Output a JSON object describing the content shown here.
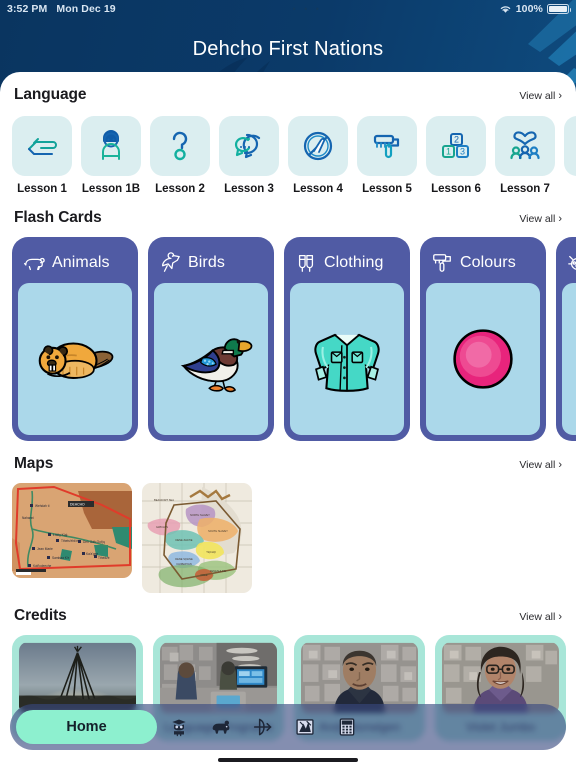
{
  "status_bar": {
    "time": "3:52 PM",
    "date": "Mon Dec 19",
    "center_dots": "• • •",
    "battery_percent": "100%",
    "wifi_icon": "wifi-icon",
    "battery_icon": "battery-full-icon"
  },
  "header": {
    "title": "Dehcho First Nations"
  },
  "sections": {
    "language": {
      "title": "Language",
      "view_all": "View all",
      "chevron": "›",
      "items": [
        {
          "label": "Lesson 1",
          "icon": "hand-greeting-icon"
        },
        {
          "label": "Lesson 1B",
          "icon": "person-child-icon"
        },
        {
          "label": "Lesson 2",
          "icon": "question-mark-icon"
        },
        {
          "label": "Lesson 3",
          "icon": "speech-bubbles-icon"
        },
        {
          "label": "Lesson 4",
          "icon": "no-utensils-icon"
        },
        {
          "label": "Lesson 5",
          "icon": "paint-roller-icon"
        },
        {
          "label": "Lesson 6",
          "icon": "number-blocks-icon"
        },
        {
          "label": "Lesson 7",
          "icon": "heart-family-icon"
        },
        {
          "label": "Le",
          "icon": "heart-partial-icon"
        }
      ]
    },
    "flash_cards": {
      "title": "Flash Cards",
      "view_all": "View all",
      "chevron": "›",
      "items": [
        {
          "label": "Animals",
          "icon": "bear-icon",
          "art": "beaver-art"
        },
        {
          "label": "Birds",
          "icon": "bird-icon",
          "art": "mallard-duck-art"
        },
        {
          "label": "Clothing",
          "icon": "mittens-icon",
          "art": "shirt-art"
        },
        {
          "label": "Colours",
          "icon": "roller-icon",
          "art": "pink-circle-art"
        },
        {
          "label": "",
          "icon": "bug-icon",
          "art": "green-insect-art"
        }
      ]
    },
    "maps": {
      "title": "Maps",
      "view_all": "View all",
      "chevron": "›",
      "items": [
        {
          "name": "dehcho-territory-map-thumbnail"
        },
        {
          "name": "regional-language-areas-map-thumbnail"
        }
      ]
    },
    "credits": {
      "title": "Credits",
      "view_all": "View all",
      "chevron": "›",
      "items": [
        {
          "name": "",
          "photo": "teepee-sunset-photo"
        },
        {
          "name": "Language Programs",
          "photo": "meeting-room-photo"
        },
        {
          "name": "Andy Norwigen",
          "photo": "portrait-man-photo"
        },
        {
          "name": "Violet Jumbo",
          "photo": "portrait-woman-photo"
        }
      ]
    }
  },
  "tab_bar": {
    "tabs": [
      {
        "label": "Home",
        "icon": "home-icon",
        "active": true
      },
      {
        "label": "",
        "icon": "graduation-owl-icon",
        "active": false
      },
      {
        "label": "",
        "icon": "bear-cards-icon",
        "active": false
      },
      {
        "label": "",
        "icon": "bow-arrow-icon",
        "active": false
      },
      {
        "label": "",
        "icon": "map-icon",
        "active": false
      },
      {
        "label": "",
        "icon": "calculator-icon",
        "active": false
      }
    ]
  },
  "colors": {
    "header_navy": "#0b3a69",
    "flash_card_purple": "#505ba4",
    "flash_card_body_blue": "#abd8ea",
    "lesson_tile_mint": "#dbeef0",
    "credits_mint": "#a8e6d8",
    "tab_active_green": "#8df0cf",
    "tab_bar_overlay": "#384880"
  }
}
